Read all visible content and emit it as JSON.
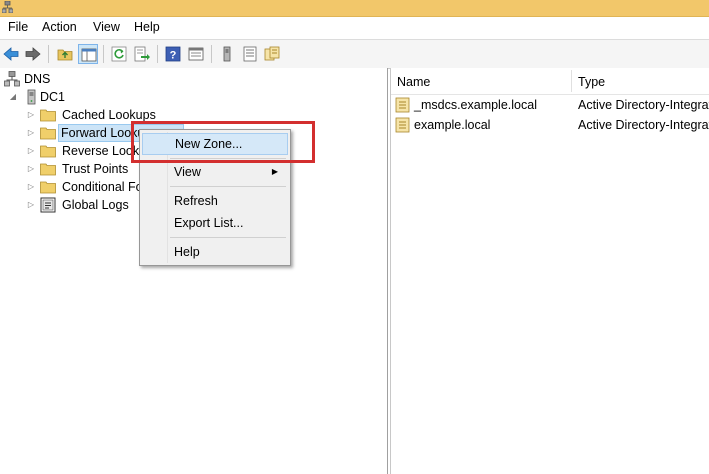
{
  "menubar": {
    "items": [
      "File",
      "Action",
      "View",
      "Help"
    ]
  },
  "toolbar": {
    "buttons": [
      {
        "name": "back-icon"
      },
      {
        "name": "forward-icon"
      },
      {
        "name": "up-folder-icon"
      },
      {
        "name": "show-hide-console-tree-icon"
      },
      {
        "name": "refresh-icon"
      },
      {
        "name": "export-list-icon"
      },
      {
        "name": "help-icon"
      },
      {
        "name": "properties-icon"
      },
      {
        "name": "server-icon"
      },
      {
        "name": "list-icon"
      },
      {
        "name": "zone-icon"
      }
    ]
  },
  "tree": {
    "root": "DNS",
    "server": "DC1",
    "items": [
      {
        "label": "Cached Lookups",
        "icon": "folder-icon"
      },
      {
        "label": "Forward Looku",
        "icon": "folder-icon",
        "selected": true
      },
      {
        "label": "Reverse Looku",
        "icon": "folder-icon"
      },
      {
        "label": "Trust Points",
        "icon": "folder-icon"
      },
      {
        "label": "Conditional Fo",
        "icon": "folder-icon"
      },
      {
        "label": "Global Logs",
        "icon": "log-icon"
      }
    ]
  },
  "list": {
    "columns": [
      "Name",
      "Type"
    ],
    "rows": [
      {
        "name": "_msdcs.example.local",
        "type": "Active Directory-Integrate"
      },
      {
        "name": "example.local",
        "type": "Active Directory-Integrate"
      }
    ]
  },
  "context_menu": {
    "new_zone": "New Zone...",
    "view": "View",
    "refresh": "Refresh",
    "export_list": "Export List...",
    "help": "Help"
  },
  "colors": {
    "title_bar": "#f2c76a",
    "selection": "#cce4f7",
    "annotation_box": "#d32f2f"
  }
}
